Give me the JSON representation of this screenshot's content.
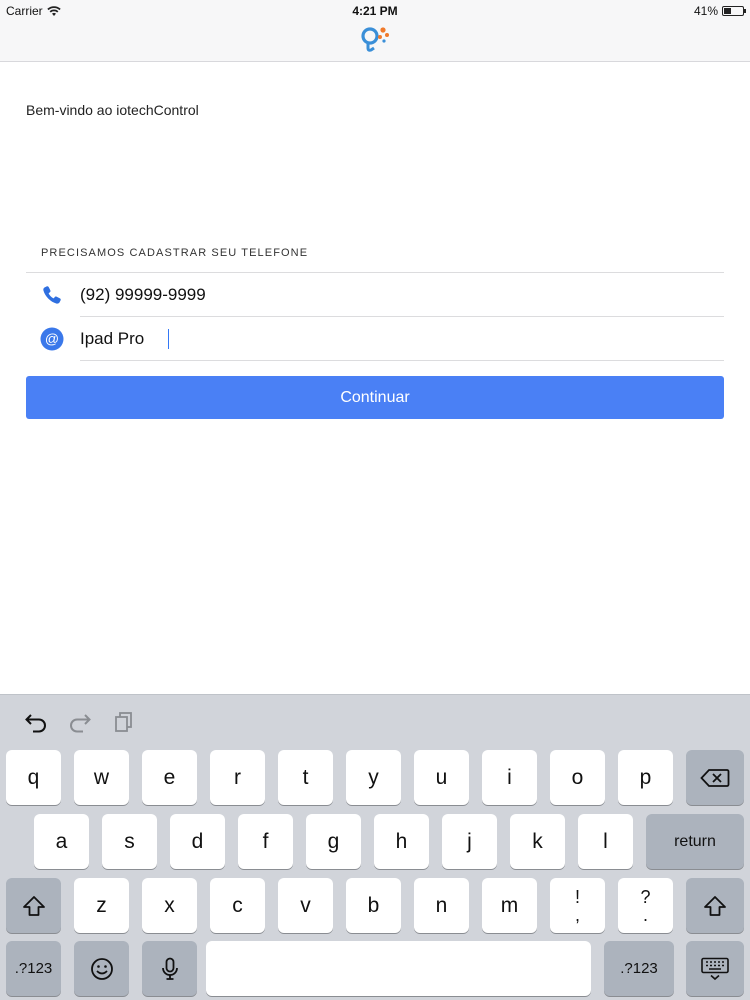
{
  "status_bar": {
    "carrier": "Carrier",
    "time": "4:21 PM",
    "battery": "41%",
    "battery_level": 0.41
  },
  "nav": {
    "logo_icon": "iotech-logo-icon",
    "colors": {
      "blue": "#3a8fd8",
      "orange": "#f07a2b"
    }
  },
  "content": {
    "welcome": "Bem-vindo ao iotechControl",
    "section_title": "PRECISAMOS CADASTRAR SEU TELEFONE",
    "phone_value": "(92) 99999-9999",
    "phone_icon": "phone-icon",
    "device_value": "Ipad Pro",
    "device_icon": "at-sign-icon",
    "continue_label": "Continuar",
    "accent": "#4a80f5"
  },
  "keyboard": {
    "toolbar": [
      "undo-icon",
      "redo-icon",
      "paste-icon"
    ],
    "row1": [
      "q",
      "w",
      "e",
      "r",
      "t",
      "y",
      "u",
      "i",
      "o",
      "p"
    ],
    "row2": [
      "a",
      "s",
      "d",
      "f",
      "g",
      "h",
      "j",
      "k",
      "l"
    ],
    "row3": [
      "z",
      "x",
      "c",
      "v",
      "b",
      "n",
      "m"
    ],
    "exclaim_top": "!",
    "exclaim_bottom": ",",
    "question_top": "?",
    "question_bottom": ".",
    "return_label": "return",
    "numbers_label": ".?123",
    "numbers_label_right": ".?123"
  }
}
